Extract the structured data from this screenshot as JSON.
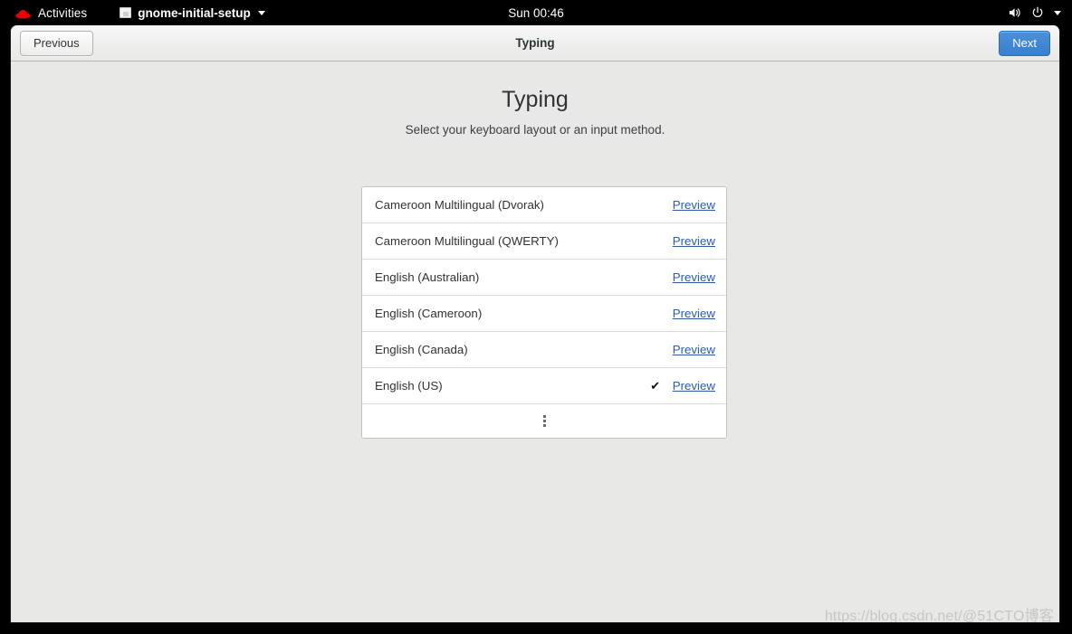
{
  "topbar": {
    "activities_label": "Activities",
    "redhat_icon": "redhat-logo-icon",
    "app_icon": "window-app-icon",
    "app_name": "gnome-initial-setup",
    "app_menu_caret": "chevron-down-icon",
    "clock": "Sun 00:46",
    "volume_icon": "volume-speaker-icon",
    "power_icon": "power-icon",
    "system_menu_caret": "chevron-down-icon"
  },
  "headerbar": {
    "previous_label": "Previous",
    "title": "Typing",
    "next_label": "Next",
    "next_accent_color": "#3b7fcc"
  },
  "page": {
    "title": "Typing",
    "subtitle": "Select your keyboard layout or an input method.",
    "preview_link_color": "#2a5db0"
  },
  "layouts": [
    {
      "name": "Cameroon Multilingual (Dvorak)",
      "selected": false,
      "check": "",
      "preview": "Preview"
    },
    {
      "name": "Cameroon Multilingual (QWERTY)",
      "selected": false,
      "check": "",
      "preview": "Preview"
    },
    {
      "name": "English (Australian)",
      "selected": false,
      "check": "",
      "preview": "Preview"
    },
    {
      "name": "English (Cameroon)",
      "selected": false,
      "check": "",
      "preview": "Preview"
    },
    {
      "name": "English (Canada)",
      "selected": false,
      "check": "",
      "preview": "Preview"
    },
    {
      "name": "English (US)",
      "selected": true,
      "check": "✔",
      "preview": "Preview"
    }
  ],
  "more_row": {
    "icon": "more-vertical-icon"
  },
  "watermark": {
    "text": "https://blog.csdn.net/@51CTO博客"
  }
}
